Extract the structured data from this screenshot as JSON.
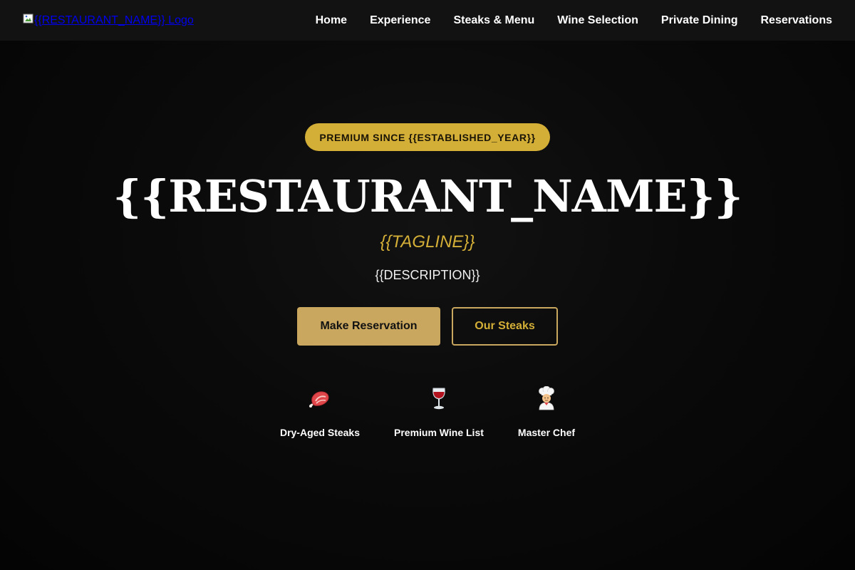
{
  "header": {
    "logo_alt": "{{RESTAURANT_NAME}} Logo",
    "nav": [
      {
        "label": "Home"
      },
      {
        "label": "Experience"
      },
      {
        "label": "Steaks & Menu"
      },
      {
        "label": "Wine Selection"
      },
      {
        "label": "Private Dining"
      },
      {
        "label": "Reservations"
      }
    ]
  },
  "hero": {
    "badge": "PREMIUM SINCE {{ESTABLISHED_YEAR}}",
    "title": "{{RESTAURANT_NAME}}",
    "tagline": "{{TAGLINE}}",
    "description": "{{DESCRIPTION}}",
    "primary_button": "Make Reservation",
    "secondary_button": "Our Steaks",
    "features": [
      {
        "icon": "steak-icon",
        "label": "Dry-Aged Steaks"
      },
      {
        "icon": "wine-glass-icon",
        "label": "Premium Wine List"
      },
      {
        "icon": "chef-icon",
        "label": "Master Chef"
      }
    ]
  },
  "colors": {
    "background": "#050505",
    "header": "#121212",
    "accent_gold": "#d4af37",
    "button_gold": "#c9a75e",
    "link_blue": "#0000ee"
  }
}
